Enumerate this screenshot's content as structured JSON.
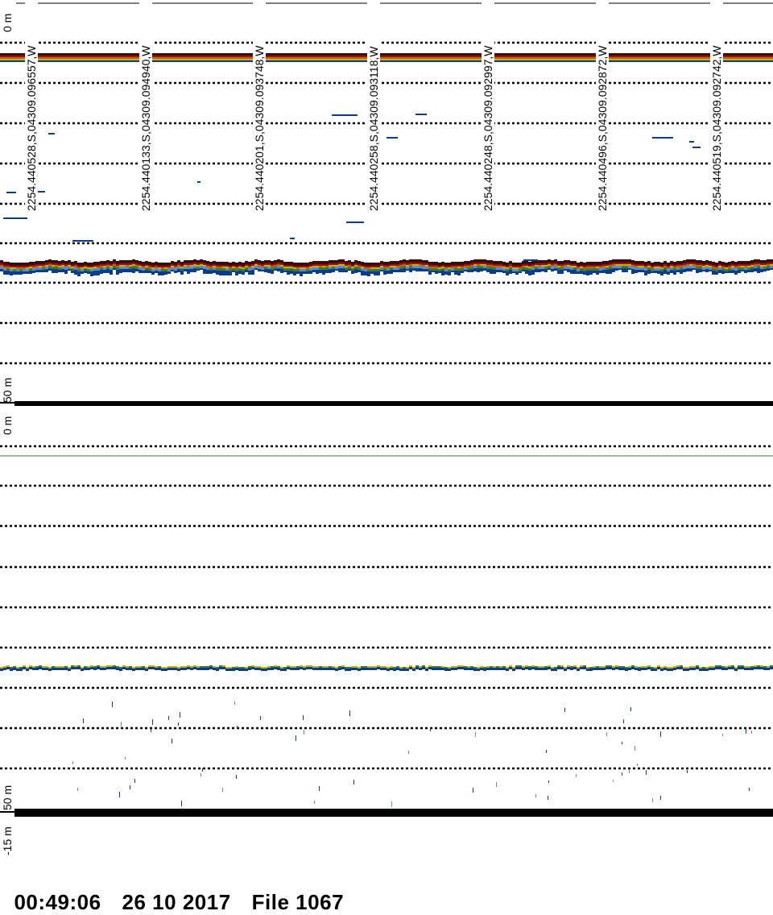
{
  "upper_panel": {
    "depth_top_label": "0 m",
    "depth_bottom_label": "50 m",
    "position_labels": [
      "2254.440528,S,04309.096557,W",
      "2254.440133,S,04309.094940,W",
      "2254.440201,S,04309.093748,W",
      "2254.440258,S,04309.093118,W",
      "2254.440248,S,04309.092997,W",
      "2254.440496,S,04309.092872,W",
      "2254.440519,S,04309.092742,W"
    ]
  },
  "lower_panel": {
    "depth_top_label": "0 m",
    "depth_bottom_label": "50 m",
    "extra_label": "-15 m"
  },
  "footer": {
    "time": "00:49:06",
    "date": "26 10 2017",
    "file": "File 1067"
  },
  "colors": {
    "echo_strong": "#3a0d0d",
    "echo_red": "#a01010",
    "echo_orange": "#c86400",
    "echo_yellow": "#c8b400",
    "echo_green": "#3a7a3a",
    "echo_blue": "#0a3c8c",
    "echo_light_blue": "#5a8cc8"
  }
}
